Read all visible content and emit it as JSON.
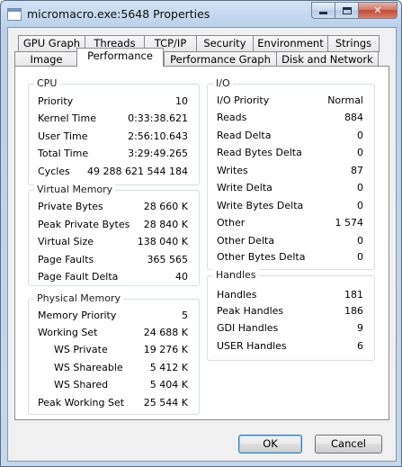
{
  "window": {
    "title": "micromacro.exe:5648 Properties",
    "buttons": {
      "minimize": "minimize",
      "maximize": "maximize",
      "close": "close"
    }
  },
  "tabs": {
    "row_top": [
      "GPU Graph",
      "Threads",
      "TCP/IP",
      "Security",
      "Environment",
      "Strings"
    ],
    "row_bottom": [
      "Image",
      "Performance",
      "Performance Graph",
      "Disk and Network"
    ],
    "active": "Performance"
  },
  "cpu": {
    "title": "CPU",
    "rows": [
      {
        "label": "Priority",
        "value": "10"
      },
      {
        "label": "Kernel Time",
        "value": "0:33:38.621"
      },
      {
        "label": "User Time",
        "value": "2:56:10.643"
      },
      {
        "label": "Total Time",
        "value": "3:29:49.265"
      },
      {
        "label": "Cycles",
        "value": "49 288 621 544 184"
      }
    ]
  },
  "virtual_memory": {
    "title": "Virtual Memory",
    "rows": [
      {
        "label": "Private Bytes",
        "value": "28 660 K"
      },
      {
        "label": "Peak Private Bytes",
        "value": "28 840 K"
      },
      {
        "label": "Virtual Size",
        "value": "138 040 K"
      },
      {
        "label": "Page Faults",
        "value": "365 565"
      },
      {
        "label": "Page Fault Delta",
        "value": "40"
      }
    ]
  },
  "physical_memory": {
    "title": "Physical Memory",
    "rows": [
      {
        "label": "Memory Priority",
        "value": "5"
      },
      {
        "label": "Working Set",
        "value": "24 688 K"
      },
      {
        "label": "WS Private",
        "value": "19 276 K"
      },
      {
        "label": "WS Shareable",
        "value": "5 412 K"
      },
      {
        "label": "WS Shared",
        "value": "5 404 K"
      },
      {
        "label": "Peak Working Set",
        "value": "25 544 K"
      }
    ]
  },
  "io": {
    "title": "I/O",
    "rows": [
      {
        "label": "I/O Priority",
        "value": "Normal"
      },
      {
        "label": "Reads",
        "value": "884"
      },
      {
        "label": "Read Delta",
        "value": "0"
      },
      {
        "label": "Read Bytes Delta",
        "value": "0"
      },
      {
        "label": "Writes",
        "value": "87"
      },
      {
        "label": "Write Delta",
        "value": "0"
      },
      {
        "label": "Write Bytes Delta",
        "value": "0"
      },
      {
        "label": "Other",
        "value": "1 574"
      },
      {
        "label": "Other Delta",
        "value": "0"
      },
      {
        "label": "Other Bytes Delta",
        "value": "0"
      }
    ]
  },
  "handles": {
    "title": "Handles",
    "rows": [
      {
        "label": "Handles",
        "value": "181"
      },
      {
        "label": "Peak Handles",
        "value": "186"
      },
      {
        "label": "GDI Handles",
        "value": "9"
      },
      {
        "label": "USER Handles",
        "value": "6"
      }
    ]
  },
  "footer": {
    "ok_label": "OK",
    "cancel_label": "Cancel"
  }
}
